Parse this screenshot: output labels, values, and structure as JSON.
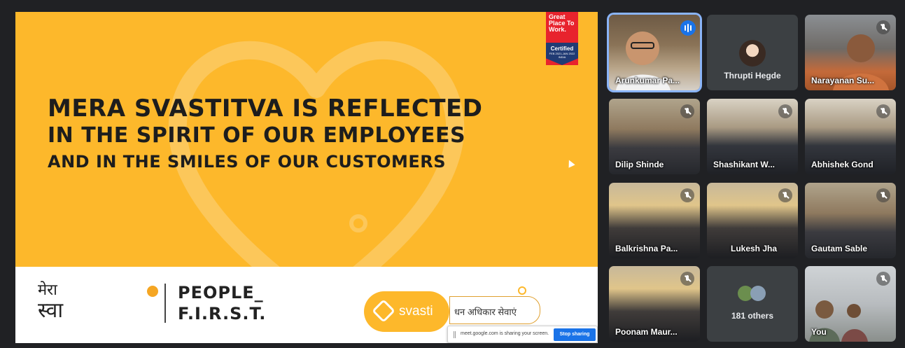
{
  "slide": {
    "headline_1": "MERA SVASTITVA IS REFLECTED",
    "headline_2": "IN THE SPIRIT OF OUR EMPLOYEES",
    "headline_3": "AND IN THE SMILES OF OUR CUSTOMERS",
    "badge_top": "Great Place To Work.",
    "badge_certified": "Certified",
    "badge_small": "FEB 2021-JAN 2022 INDIA",
    "mera_line1": "मेरा",
    "mera_line2_a": "स्व",
    "mera_line2_b": "ास्तित्व",
    "people_line1": "PEOPLE_",
    "people_line2": "F.I.R.S.T.",
    "svasti_word": "svasti",
    "tagline": "धन अधिकार सेवाएं",
    "colors": {
      "yellow": "#fdb82b",
      "text": "#1d1d1d"
    }
  },
  "share_bar": {
    "message": "meet.google.com is sharing your screen.",
    "stop_label": "Stop sharing"
  },
  "participants": [
    {
      "name": "Arunkumar Pa...",
      "state": "speaking"
    },
    {
      "name": "Thrupti Hegde",
      "state": "avatar"
    },
    {
      "name": "Narayanan Su...",
      "state": "muted"
    },
    {
      "name": "Dilip Shinde",
      "state": "muted"
    },
    {
      "name": "Shashikant W...",
      "state": "muted"
    },
    {
      "name": "Abhishek Gond",
      "state": "muted"
    },
    {
      "name": "Balkrishna Pa...",
      "state": "muted"
    },
    {
      "name": "Lukesh Jha",
      "state": "muted"
    },
    {
      "name": "Gautam Sable",
      "state": "muted"
    },
    {
      "name": "Poonam Maur...",
      "state": "muted"
    },
    {
      "name": "181 others",
      "state": "others"
    },
    {
      "name": "You",
      "state": "muted"
    }
  ]
}
